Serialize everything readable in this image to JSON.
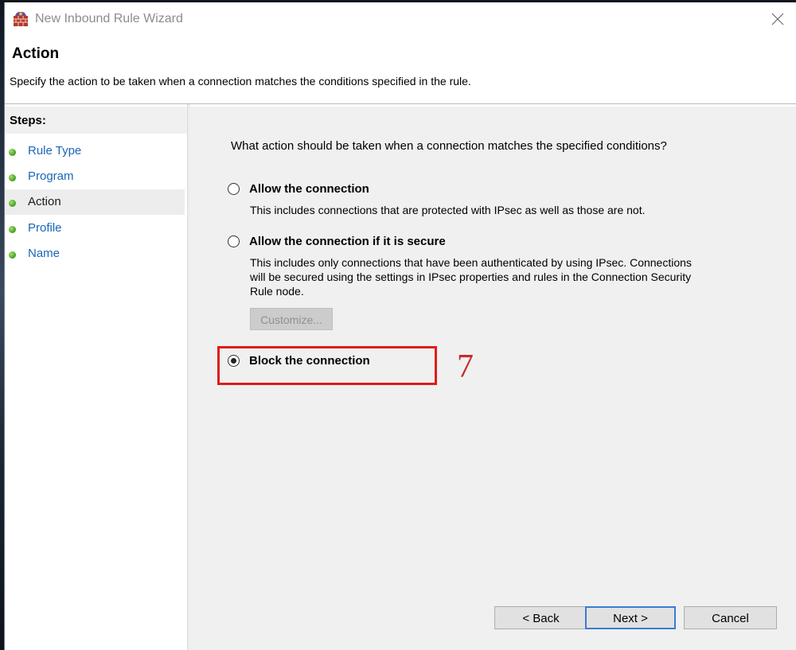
{
  "window": {
    "title": "New Inbound Rule Wizard",
    "app_icon": "firewall-icon",
    "close_icon": "close-icon"
  },
  "header": {
    "title": "Action",
    "description": "Specify the action to be taken when a connection matches the conditions specified in the rule."
  },
  "sidebar": {
    "heading": "Steps:",
    "items": [
      {
        "label": "Rule Type",
        "current": false
      },
      {
        "label": "Program",
        "current": false
      },
      {
        "label": "Action",
        "current": true
      },
      {
        "label": "Profile",
        "current": false
      },
      {
        "label": "Name",
        "current": false
      }
    ]
  },
  "main": {
    "question": "What action should be taken when a connection matches the specified conditions?",
    "options": [
      {
        "label": "Allow the connection",
        "description": "This includes connections that are protected with IPsec as well as those are not.",
        "selected": false
      },
      {
        "label": "Allow the connection if it is secure",
        "description_lines": [
          "This includes only connections that have been authenticated by using IPsec.  Connections",
          "will be secured using the settings in IPsec properties and rules in the Connection Security",
          "Rule node."
        ],
        "selected": false
      },
      {
        "label": "Block the connection",
        "selected": true
      }
    ],
    "customize_label": "Customize...",
    "annotation": "7"
  },
  "footer": {
    "back_label": "< Back",
    "next_label": "Next >",
    "cancel_label": "Cancel"
  },
  "colors": {
    "link": "#1a66b8",
    "annotation": "#e01b1b",
    "panel_bg": "#f0f0f0",
    "step_dot": "#3f9c1e",
    "primary_border": "#3b7ad9"
  }
}
